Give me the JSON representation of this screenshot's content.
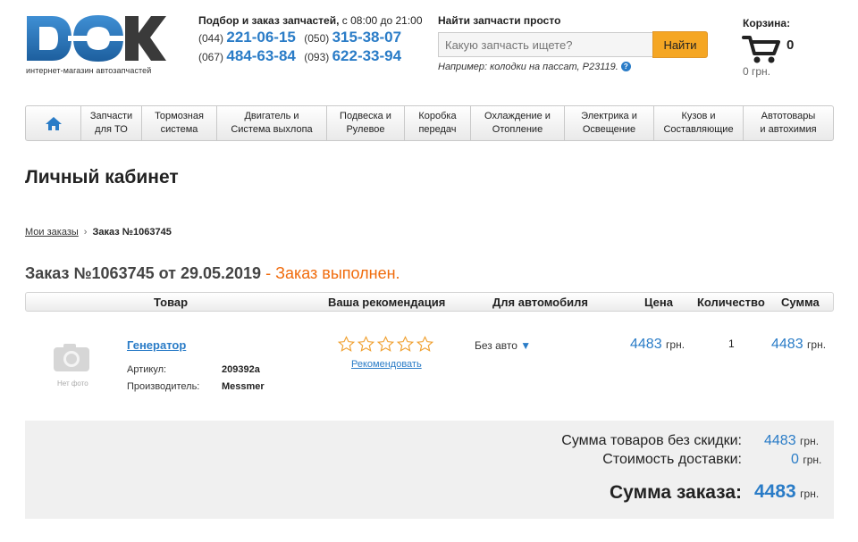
{
  "header": {
    "logo_text": "DOK",
    "logo_tagline": "интернет-магазин автозапчастей",
    "hours_title": "Подбор и заказ запчастей,",
    "hours_time": "с 08:00 до 21:00",
    "phones": [
      {
        "code": "(044)",
        "number": "221-06-15"
      },
      {
        "code": "(050)",
        "number": "315-38-07"
      },
      {
        "code": "(067)",
        "number": "484-63-84"
      },
      {
        "code": "(093)",
        "number": "622-33-94"
      }
    ],
    "search_title": "Найти запчасти просто",
    "search_placeholder": "Какую запчасть ищете?",
    "search_button": "Найти",
    "search_hint": "Например: колодки на пассат, P23119.",
    "help_glyph": "?",
    "cart_title": "Корзина:",
    "cart_count": "0",
    "cart_sum": "0 грн."
  },
  "nav": [
    {
      "l1": "Запчасти",
      "l2": "для ТО"
    },
    {
      "l1": "Тормозная",
      "l2": "система"
    },
    {
      "l1": "Двигатель и",
      "l2": "Система выхлопа"
    },
    {
      "l1": "Подвеска и",
      "l2": "Рулевое"
    },
    {
      "l1": "Коробка",
      "l2": "передач"
    },
    {
      "l1": "Охлаждение и",
      "l2": "Отопление"
    },
    {
      "l1": "Электрика и",
      "l2": "Освещение"
    },
    {
      "l1": "Кузов и",
      "l2": "Составляющие"
    },
    {
      "l1": "Автотовары",
      "l2": "и автохимия"
    }
  ],
  "page": {
    "title": "Личный кабинет",
    "crumb_link": "Мои заказы",
    "crumb_sep": "›",
    "crumb_current": "Заказ №1063745",
    "order_heading": "Заказ №1063745 от 29.05.2019",
    "order_status": " - Заказ выполнен."
  },
  "table": {
    "headers": {
      "product": "Товар",
      "recommend": "Ваша рекомендация",
      "car": "Для автомобиля",
      "price": "Цена",
      "qty": "Количество",
      "sum": "Сумма"
    },
    "row": {
      "photo_label": "Нет фото",
      "name": "Генератор",
      "article_label": "Артикул:",
      "article": "209392a",
      "maker_label": "Производитель:",
      "maker": "Messmer",
      "recommend_link": "Рекомендовать",
      "rating": 0,
      "car": "Без авто",
      "car_arrow": "▼",
      "price": "4483",
      "price_cur": "грн.",
      "qty": "1",
      "sum": "4483",
      "sum_cur": "грн."
    }
  },
  "summary": {
    "goods_label": "Сумма товаров без скидки:",
    "goods_value": "4483",
    "delivery_label": "Стоимость доставки:",
    "delivery_value": "0",
    "total_label": "Сумма заказа:",
    "total_value": "4483",
    "currency": "грн."
  },
  "colors": {
    "accent": "#2a7cc7",
    "status": "#f06b0c",
    "button": "#f5a623"
  }
}
